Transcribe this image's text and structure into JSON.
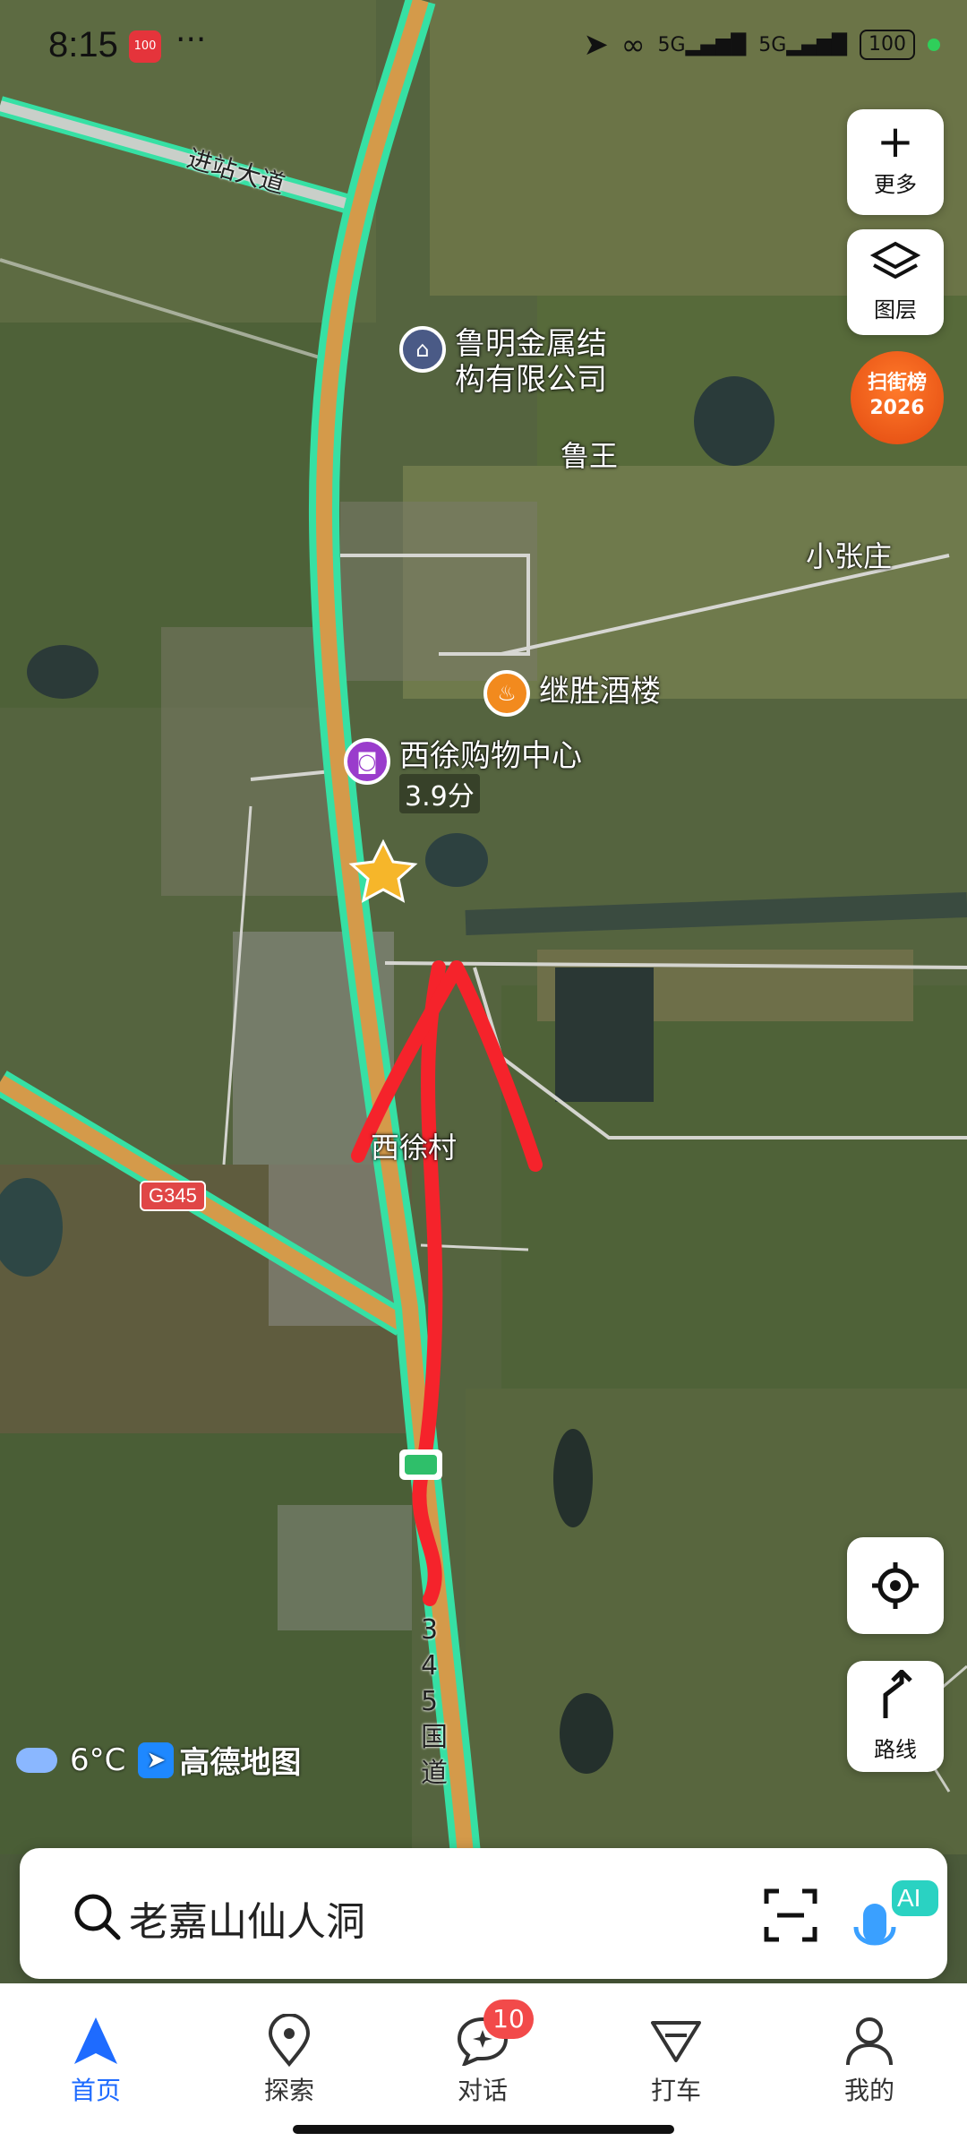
{
  "status_bar": {
    "time": "8:15",
    "app_badge": "100",
    "dots": "···",
    "network_1": "5G",
    "network_2": "5G",
    "battery": "100"
  },
  "map": {
    "road_labels": {
      "station_avenue": "进站大道",
      "highway_shield": "G345",
      "national_road": "345国道"
    },
    "pois": [
      {
        "name_line1": "鲁明金属结",
        "name_line2": "构有限公司",
        "icon": "building-pin-icon"
      },
      {
        "name": "继胜酒楼",
        "icon": "restaurant-pin-icon"
      },
      {
        "name": "西徐购物中心",
        "score": "3.9分",
        "icon": "shopping-pin-icon"
      }
    ],
    "place_labels": {
      "luwang": "鲁王",
      "xiaozhangzhuang": "小张庄",
      "xixucun": "西徐村"
    }
  },
  "side_buttons": {
    "more": {
      "label": "更多",
      "icon": "plus-icon"
    },
    "layers": {
      "label": "图层",
      "icon": "layers-icon"
    },
    "campaign": {
      "line1": "扫街榜",
      "line2": "2026"
    },
    "locate": {
      "icon": "locate-icon"
    },
    "route": {
      "label": "路线",
      "icon": "route-arrow-icon"
    }
  },
  "weather": {
    "temperature": "6°C",
    "brand": "高德地图"
  },
  "search": {
    "query": "老嘉山仙人洞",
    "ai_label": "AI"
  },
  "tabs": [
    {
      "label": "首页",
      "active": true,
      "icon": "navigate-icon"
    },
    {
      "label": "探索",
      "active": false,
      "icon": "location-pin-icon"
    },
    {
      "label": "对话",
      "active": false,
      "icon": "chat-icon",
      "badge": "10"
    },
    {
      "label": "打车",
      "active": false,
      "icon": "taxi-icon"
    },
    {
      "label": "我的",
      "active": false,
      "icon": "person-icon"
    }
  ],
  "colors": {
    "accent": "#1e6bff",
    "road_fill": "#d49a4a",
    "road_edge": "#2ee0a0",
    "annotation_red": "#f5232b",
    "poi_building": "#4a5a86",
    "poi_restaurant": "#f28a1e",
    "poi_shopping": "#9a3ccc"
  }
}
